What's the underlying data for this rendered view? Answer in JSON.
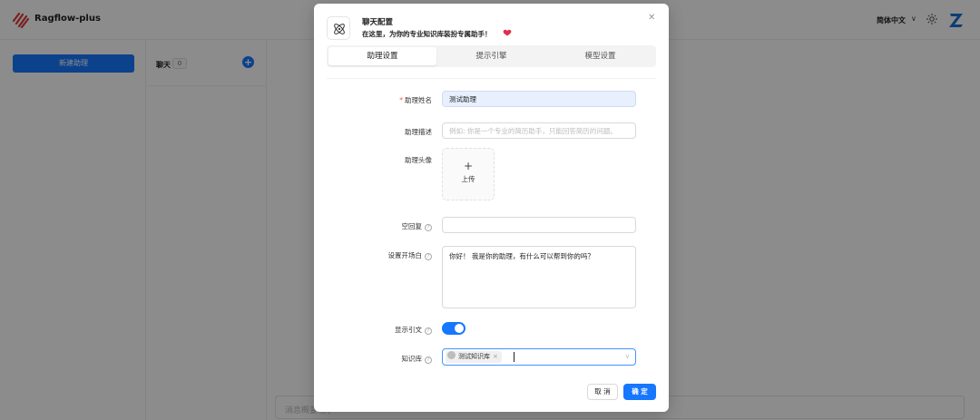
{
  "app": {
    "title": "Ragflow-plus",
    "language": "简体中文",
    "new_assistant_label": "新建助理",
    "chat_list_title": "聊天",
    "chat_count": "0",
    "message_placeholder": "消息概要助手"
  },
  "modal": {
    "title": "聊天配置",
    "subtitle": "在这里，为你的专业知识库装扮专属助手！",
    "tabs": [
      {
        "label": "助理设置",
        "active": true
      },
      {
        "label": "提示引擎",
        "active": false
      },
      {
        "label": "模型设置",
        "active": false
      }
    ],
    "fields": {
      "name": {
        "label": "助理姓名",
        "required": true,
        "value": "测试助理"
      },
      "description": {
        "label": "助理描述",
        "placeholder": "例如: 你是一个专业的简历助手，只能回答简历的问题。"
      },
      "avatar": {
        "label": "助理头像",
        "upload_label": "上传",
        "plus": "+"
      },
      "empty_reply": {
        "label": "空回复",
        "value": ""
      },
      "opener": {
        "label": "设置开场白",
        "value": "你好！ 我是你的助理，有什么可以帮到你的吗？"
      },
      "show_quote": {
        "label": "显示引文",
        "enabled": true
      },
      "knowledge_base": {
        "label": "知识库",
        "selected": [
          "测试知识库"
        ]
      }
    },
    "buttons": {
      "cancel": "取 消",
      "ok": "确 定"
    }
  },
  "colors": {
    "accent": "#1677ff",
    "required": "#ff4d4f",
    "logo": "#e03a3a",
    "avatar": "#1a6fd6"
  }
}
